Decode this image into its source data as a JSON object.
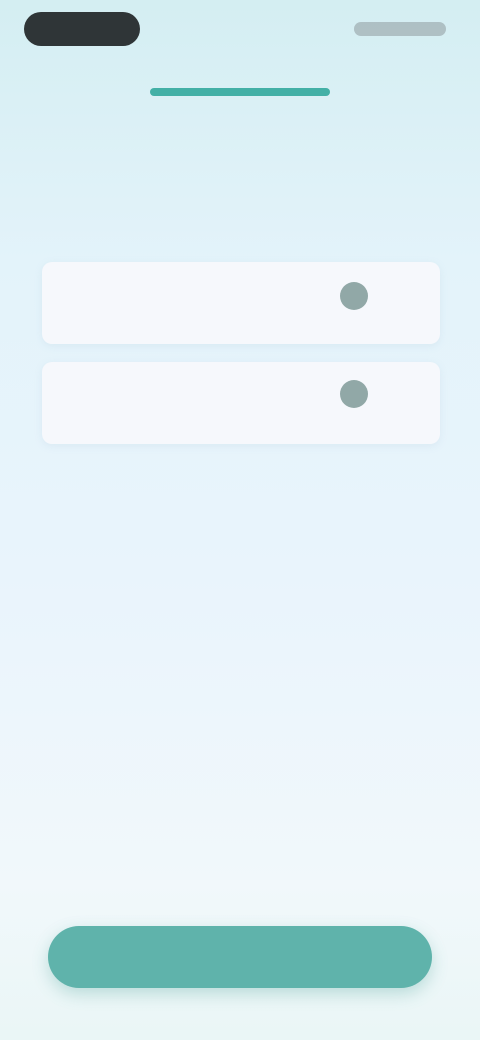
{
  "progress": {
    "fraction": 1.0
  },
  "heading": "",
  "description": "",
  "options": [
    {
      "title": "",
      "subtitle": ""
    },
    {
      "title": "",
      "subtitle": ""
    }
  ],
  "continue_button": {
    "label": ""
  },
  "colors": {
    "accent": "#5fb3ab",
    "progress": "#43b0a6",
    "time_pill": "#2f3537",
    "background_top": "#d4eef2",
    "background_bottom": "#f1f8fb"
  }
}
